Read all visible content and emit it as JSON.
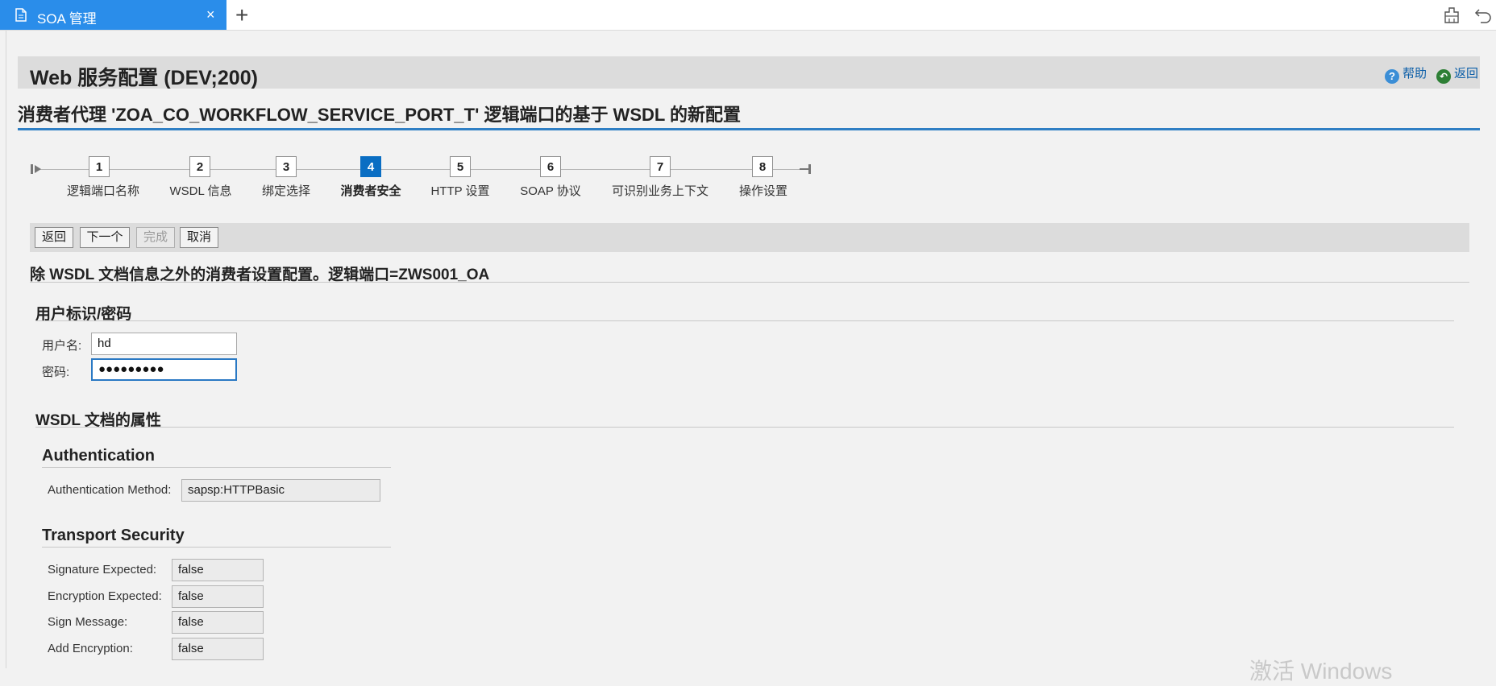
{
  "browser": {
    "tab_title": "SOA 管理",
    "close_glyph": "×",
    "newtab_glyph": "+"
  },
  "header": {
    "title": "Web 服务配置 (DEV;200)",
    "help": "帮助",
    "back": "返回"
  },
  "subtitle": "消费者代理 'ZOA_CO_WORKFLOW_SERVICE_PORT_T' 逻辑端口的基于 WSDL 的新配置",
  "roadmap": {
    "active_step": 4,
    "steps": [
      {
        "num": "1",
        "label": "逻辑端口名称"
      },
      {
        "num": "2",
        "label": "WSDL 信息"
      },
      {
        "num": "3",
        "label": "绑定选择"
      },
      {
        "num": "4",
        "label": "消费者安全"
      },
      {
        "num": "5",
        "label": "HTTP 设置"
      },
      {
        "num": "6",
        "label": "SOAP 协议"
      },
      {
        "num": "7",
        "label": "可识别业务上下文"
      },
      {
        "num": "8",
        "label": "操作设置"
      }
    ]
  },
  "toolbar": {
    "back": "返回",
    "next": "下一个",
    "finish": "完成",
    "cancel": "取消"
  },
  "section_title": "除 WSDL 文档信息之外的消费者设置配置。逻辑端口=ZWS001_OA",
  "user_group": {
    "title": "用户标识/密码",
    "username_label": "用户名:",
    "username_value": "hd",
    "password_label": "密码:",
    "password_value": "●●●●●●●●●"
  },
  "wsdl_group": {
    "title": "WSDL 文档的属性",
    "auth": {
      "title": "Authentication",
      "method_label": "Authentication Method:",
      "method_value": "sapsp:HTTPBasic"
    },
    "transport": {
      "title": "Transport Security",
      "fields": [
        {
          "label": "Signature Expected:",
          "value": "false"
        },
        {
          "label": "Encryption Expected:",
          "value": "false"
        },
        {
          "label": "Sign Message:",
          "value": "false"
        },
        {
          "label": "Add Encryption:",
          "value": "false"
        }
      ]
    }
  },
  "watermark": "激活 Windows",
  "colors": {
    "tab_blue": "#2a8dea",
    "active_step": "#0a6ec3",
    "accent_line": "#2f7fc4"
  }
}
